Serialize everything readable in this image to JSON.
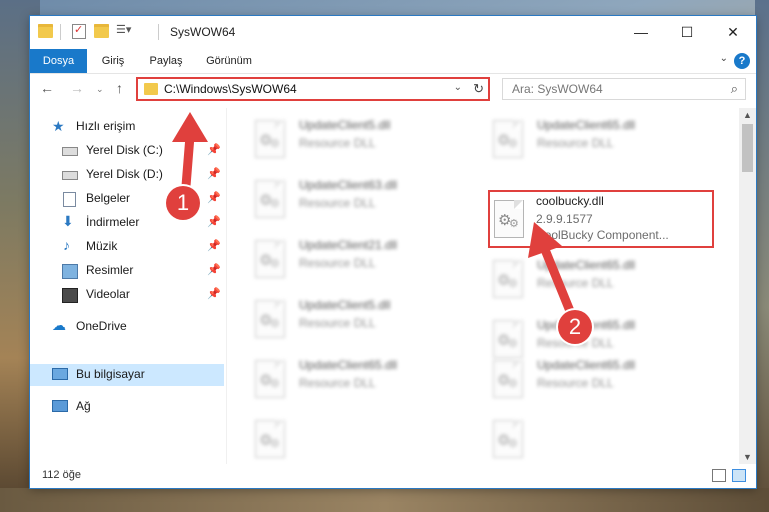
{
  "window": {
    "title": "SysWOW64"
  },
  "ribbon": {
    "tabs": [
      "Dosya",
      "Giriş",
      "Paylaş",
      "Görünüm"
    ],
    "help": "?"
  },
  "address": {
    "path": "C:\\Windows\\SysWOW64"
  },
  "search": {
    "placeholder": "Ara: SysWOW64"
  },
  "sidebar": {
    "items": [
      {
        "label": "Hızlı erişim",
        "icon": "star-icon"
      },
      {
        "label": "Yerel Disk (C:)",
        "icon": "drive-icon",
        "pinned": true
      },
      {
        "label": "Yerel Disk (D:)",
        "icon": "drive-icon",
        "pinned": true
      },
      {
        "label": "Belgeler",
        "icon": "document-icon",
        "pinned": true
      },
      {
        "label": "İndirmeler",
        "icon": "download-icon",
        "pinned": true
      },
      {
        "label": "Müzik",
        "icon": "music-icon",
        "pinned": true
      },
      {
        "label": "Resimler",
        "icon": "pictures-icon",
        "pinned": true
      },
      {
        "label": "Videolar",
        "icon": "video-icon",
        "pinned": true
      },
      {
        "label": "OneDrive",
        "icon": "cloud-icon"
      },
      {
        "label": "Bu bilgisayar",
        "icon": "computer-icon",
        "selected": true
      },
      {
        "label": "Ağ",
        "icon": "network-icon"
      }
    ]
  },
  "files": [
    {
      "name": "UpdateClient5.dll",
      "type": "Resource DLL"
    },
    {
      "name": "UpdateClient65.dll",
      "type": "Resource DLL"
    },
    {
      "name": "UpdateClient63.dll",
      "type": "Resource DLL"
    },
    {
      "name": "coolbucky.dll",
      "version": "2.9.9.1577",
      "description": "CoolBucky Component...",
      "highlighted": true
    },
    {
      "name": "UpdateClient21.dll",
      "type": "Resource DLL"
    },
    {
      "name": "UpdateClient65.dll",
      "type": "Resource DLL"
    },
    {
      "name": "UpdateClient5.dll",
      "type": "Resource DLL"
    },
    {
      "name": "UpdateClient65.dll",
      "type": "Resource DLL"
    },
    {
      "name": "UpdateClient65.dll",
      "type": "Resource DLL"
    },
    {
      "name": "UpdateClient65.dll",
      "type": "Resource DLL"
    }
  ],
  "status": {
    "item_count": "112 öğe"
  },
  "callouts": [
    "1",
    "2"
  ],
  "colors": {
    "accent": "#1979ca",
    "highlight": "#e0403d",
    "selected": "#cce8ff"
  }
}
